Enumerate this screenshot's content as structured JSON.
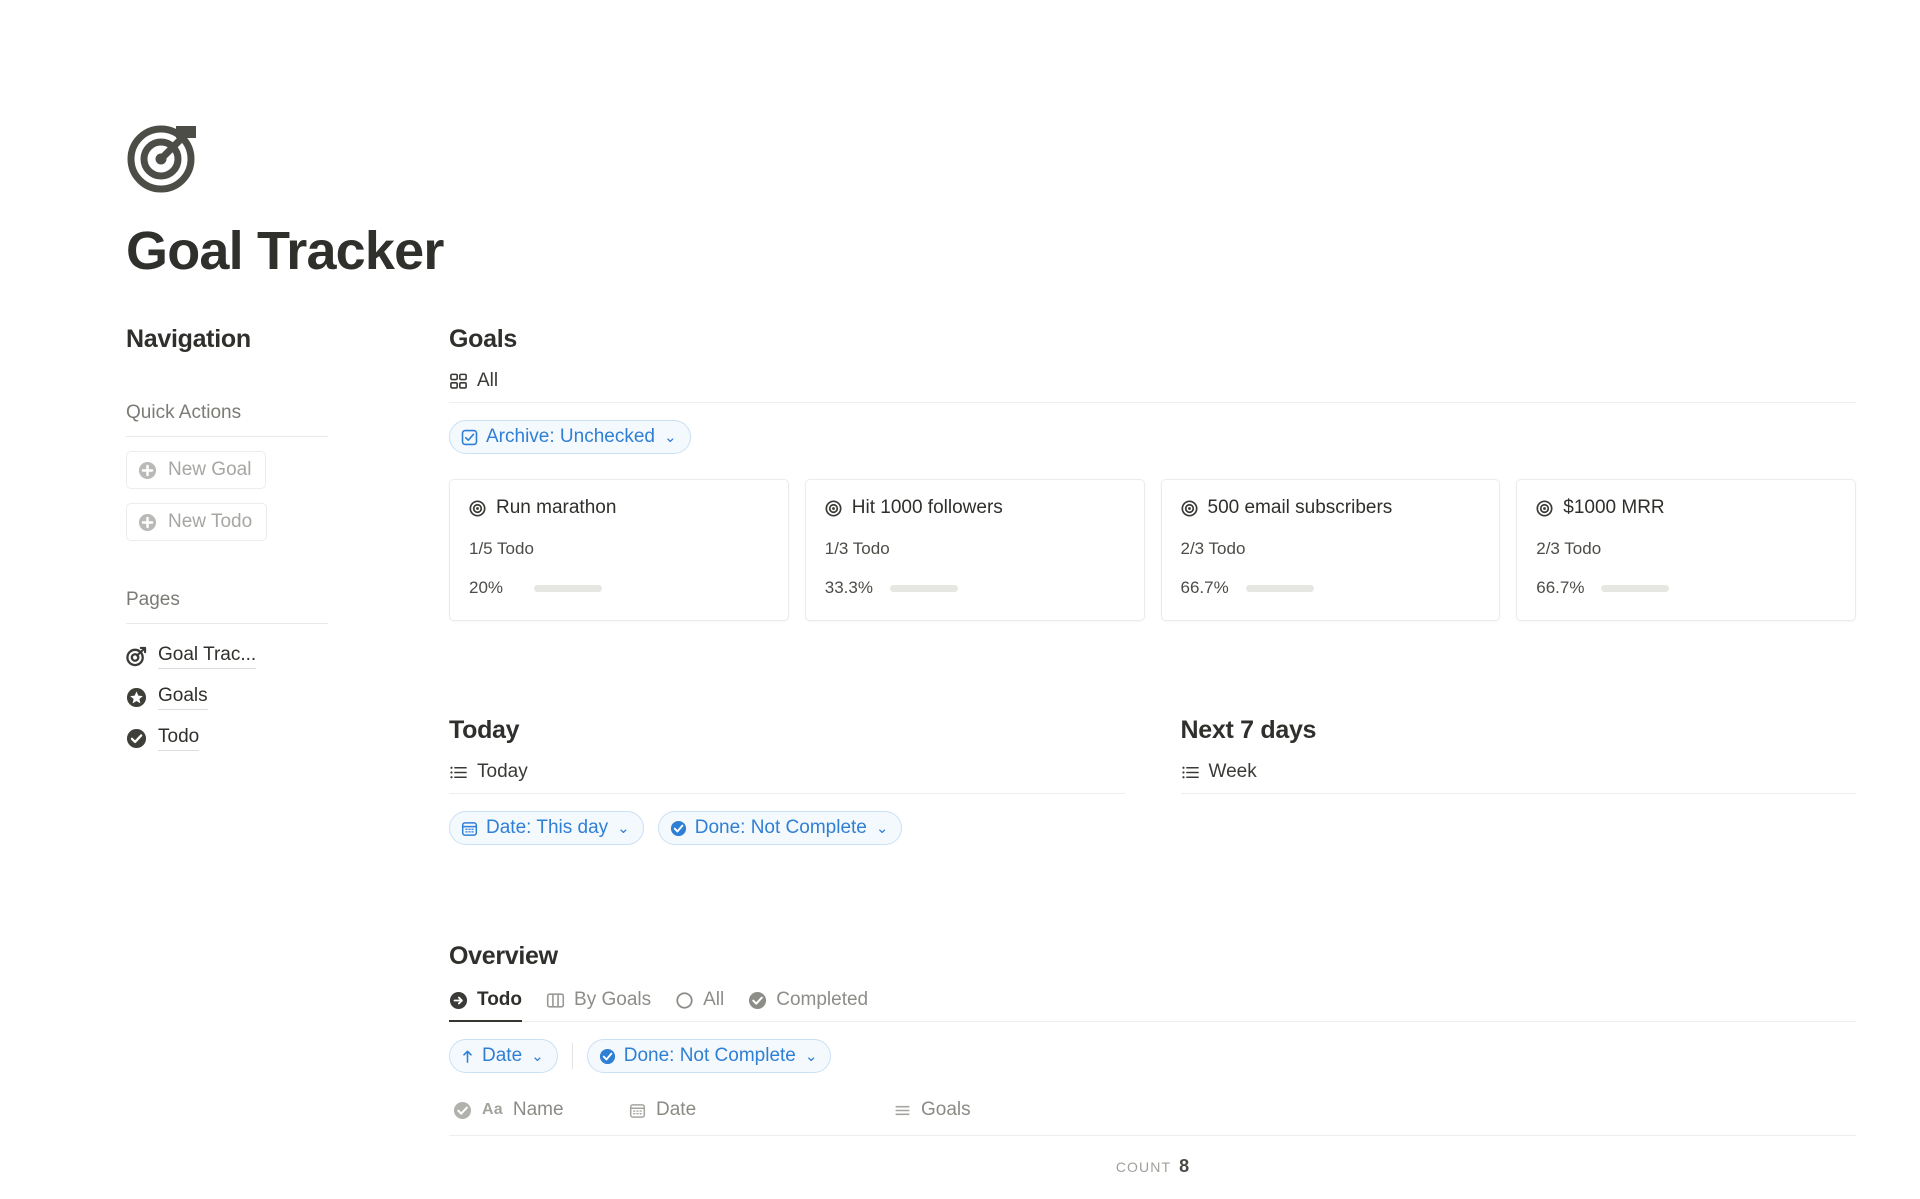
{
  "header": {
    "icon": "target-icon",
    "title": "Goal Tracker"
  },
  "sidebar": {
    "heading": "Navigation",
    "quick_actions": {
      "label": "Quick Actions",
      "buttons": [
        {
          "label": "New Goal",
          "icon": "plus-circle-icon"
        },
        {
          "label": "New Todo",
          "icon": "plus-circle-icon"
        }
      ]
    },
    "pages": {
      "label": "Pages",
      "items": [
        {
          "label": "Goal Trac...",
          "icon": "target-arrow-icon"
        },
        {
          "label": "Goals",
          "icon": "star-circle-icon"
        },
        {
          "label": "Todo",
          "icon": "check-circle-icon"
        }
      ]
    }
  },
  "goals_section": {
    "title": "Goals",
    "view_tab": {
      "label": "All",
      "icon": "gallery-grid-icon"
    },
    "filters": [
      {
        "label": "Archive: Unchecked",
        "icon": "checkbox-icon",
        "chevron": "⌄"
      }
    ],
    "cards": [
      {
        "title": "Run marathon",
        "icon": "target-icon",
        "todo": "1/5 Todo",
        "percent_label": "20%",
        "percent": 20
      },
      {
        "title": "Hit 1000 followers",
        "icon": "target-icon",
        "todo": "1/3 Todo",
        "percent_label": "33.3%",
        "percent": 33.3
      },
      {
        "title": "500 email subscribers",
        "icon": "target-icon",
        "todo": "2/3 Todo",
        "percent_label": "66.7%",
        "percent": 66.7
      },
      {
        "title": "$1000 MRR",
        "icon": "target-icon",
        "todo": "2/3 Todo",
        "percent_label": "66.7%",
        "percent": 66.7
      }
    ],
    "progress_color": "#5f9270",
    "track_color": "#e6e6e3"
  },
  "today_section": {
    "title": "Today",
    "view_tab": {
      "label": "Today",
      "icon": "list-icon"
    },
    "filters": [
      {
        "label": "Date: This day",
        "icon": "calendar-icon",
        "chevron": "⌄"
      },
      {
        "label": "Done: Not Complete",
        "icon": "check-circle-filled-icon",
        "chevron": "⌄"
      }
    ]
  },
  "next7_section": {
    "title": "Next 7 days",
    "view_tab": {
      "label": "Week",
      "icon": "list-icon"
    },
    "filters": []
  },
  "overview_section": {
    "title": "Overview",
    "tabs": [
      {
        "label": "Todo",
        "icon": "arrow-right-circle-icon",
        "active": true
      },
      {
        "label": "By Goals",
        "icon": "board-columns-icon",
        "active": false
      },
      {
        "label": "All",
        "icon": "circle-icon",
        "active": false
      },
      {
        "label": "Completed",
        "icon": "check-circle-icon",
        "active": false
      }
    ],
    "sort": {
      "label": "Date",
      "icon": "arrow-up-icon",
      "chevron": "⌄"
    },
    "filters": [
      {
        "label": "Done: Not Complete",
        "icon": "check-circle-filled-icon",
        "chevron": "⌄"
      }
    ],
    "table": {
      "columns": [
        {
          "label": "Name",
          "icon": "text-aa-icon",
          "prefix": "Aa"
        },
        {
          "label": "Date",
          "icon": "calendar-icon"
        },
        {
          "label": "Goals",
          "icon": "relation-lines-icon"
        }
      ],
      "checkbox_header_icon": "check-circle-icon",
      "rows": []
    },
    "count": {
      "label": "Count",
      "value": "8"
    }
  },
  "colors": {
    "accent_blue": "#2f7fd4",
    "chip_bg": "#f4f9fe",
    "chip_border": "#c9e0f5",
    "progress_green": "#5f9270",
    "text_primary": "#2f2f2c",
    "text_muted": "#8b8b86"
  }
}
